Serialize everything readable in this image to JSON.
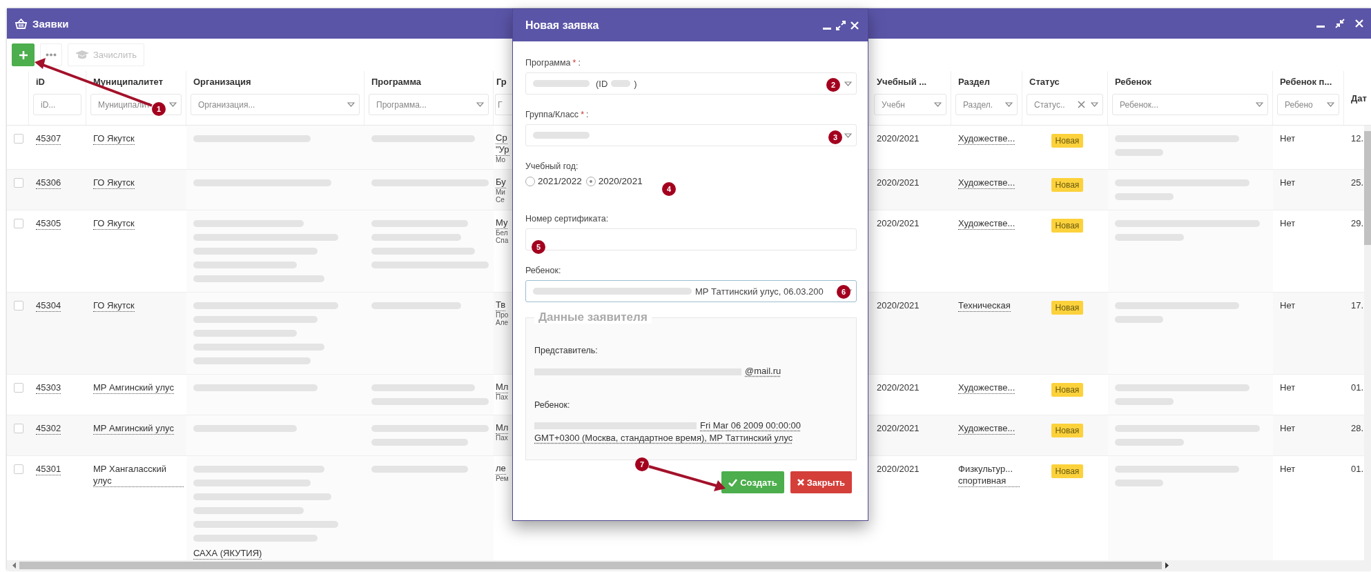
{
  "window": {
    "title": "Заявки"
  },
  "toolbar": {
    "enroll": {
      "label": "Зачислить",
      "disabled": true
    }
  },
  "table": {
    "columns": [
      {
        "title": "iD",
        "placeholder": "iD...",
        "dropdown": false
      },
      {
        "title": "Муниципалитет",
        "placeholder": "Муниципалит",
        "dropdown": true
      },
      {
        "title": "Организация",
        "placeholder": "Организация...",
        "dropdown": true
      },
      {
        "title": "Программа",
        "placeholder": "Программа...",
        "dropdown": true
      },
      {
        "title": "Гр",
        "placeholder": "Г",
        "dropdown": false
      },
      {
        "title": "Учебный ...",
        "placeholder": "Учебн",
        "dropdown": true
      },
      {
        "title": "Раздел",
        "placeholder": "Раздел.",
        "dropdown": true
      },
      {
        "title": "Статус",
        "placeholder": "Статус..",
        "dropdown": true,
        "clearable": true
      },
      {
        "title": "Ребенок",
        "placeholder": "Ребенок...",
        "dropdown": true
      },
      {
        "title": "Ребенок п...",
        "placeholder": "Ребено",
        "dropdown": true
      },
      {
        "title": "Дат"
      }
    ],
    "rows": [
      {
        "checked": false,
        "id": "45307",
        "municipality": "ГО Якутск",
        "group": [
          {
            "text": "Ср",
            "kind": "link"
          },
          {
            "text": "\"Ур",
            "kind": "link"
          },
          {
            "text": "Мо",
            "kind": "note"
          }
        ],
        "year": "2020/2021",
        "section": "Художестве...",
        "status": "Новая",
        "child_flag": "Нет",
        "date": "12."
      },
      {
        "checked": false,
        "id": "45306",
        "municipality": "ГО Якутск",
        "group": [
          {
            "text": "Бу",
            "kind": "link"
          },
          {
            "text": "Ми",
            "kind": "note"
          },
          {
            "text": "Се",
            "kind": "note"
          }
        ],
        "year": "2020/2021",
        "section": "Художестве...",
        "status": "Новая",
        "child_flag": "Нет",
        "date": "25."
      },
      {
        "checked": false,
        "id": "45305",
        "municipality": "ГО Якутск",
        "group": [
          {
            "text": "Му",
            "kind": "link"
          },
          {
            "text": "Бел",
            "kind": "note"
          },
          {
            "text": "Спа",
            "kind": "note"
          }
        ],
        "year": "2020/2021",
        "section": "Художестве...",
        "status": "Новая",
        "child_flag": "Нет",
        "date": "29."
      },
      {
        "checked": false,
        "id": "45304",
        "municipality": "ГО Якутск",
        "group": [
          {
            "text": "Тв",
            "kind": "link"
          },
          {
            "text": "Про",
            "kind": "note"
          },
          {
            "text": "Але",
            "kind": "note"
          }
        ],
        "year": "2020/2021",
        "section": "Техническая",
        "status": "Новая",
        "child_flag": "Нет",
        "date": "17."
      },
      {
        "checked": false,
        "id": "45303",
        "municipality": "МР Амгинский улус",
        "group": [
          {
            "text": "Мл",
            "kind": "link"
          },
          {
            "text": "Пах",
            "kind": "note"
          }
        ],
        "year": "2020/2021",
        "section": "Художестве...",
        "status": "Новая",
        "child_flag": "Нет",
        "date": "01."
      },
      {
        "checked": false,
        "id": "45302",
        "municipality": "МР Амгинский улус",
        "group": [
          {
            "text": "Мл",
            "kind": "link"
          },
          {
            "text": "Пах",
            "kind": "note"
          }
        ],
        "year": "2020/2021",
        "section": "Художестве...",
        "status": "Новая",
        "child_flag": "Нет",
        "date": "28."
      },
      {
        "checked": false,
        "id": "45301",
        "municipality": "МР Хангаласский улус",
        "organization_tail": "САХА (ЯКУТИЯ)",
        "group": [
          {
            "text": "ле",
            "kind": "link"
          },
          {
            "text": "Рем",
            "kind": "note"
          }
        ],
        "year": "2020/2021",
        "section": "Физкультур... спортивная",
        "status": "Новая",
        "child_flag": "Нет",
        "date": "01."
      }
    ]
  },
  "dialog": {
    "title": "Новая заявка",
    "fields": [
      {
        "kind": "select",
        "label": "Программа",
        "required_mark": "*",
        "suffix": ":",
        "value_before": "(ID",
        "value_after": ")"
      },
      {
        "kind": "select",
        "label": "Группа/Класс",
        "required_mark": "*",
        "suffix": ":"
      },
      {
        "kind": "radio",
        "label": "Учебный год:",
        "options": [
          {
            "label": "2021/2022",
            "selected": false
          },
          {
            "label": "2020/2021",
            "selected": true
          }
        ]
      },
      {
        "kind": "input",
        "label": "Номер сертификата:"
      },
      {
        "kind": "combo",
        "label": "Ребенок:",
        "value": "МР Таттинский улус, 06.03.200",
        "focused": true
      }
    ],
    "applicant": {
      "legend": "Данные заявителя",
      "items": [
        {
          "label": "Представитель:",
          "value": "@mail.ru"
        },
        {
          "label": "Ребенок:",
          "value": "Fri Mar 06 2009 00:00:00 GMT+0300 (Москва, стандартное время), МР Таттинский улус"
        }
      ]
    },
    "buttons": [
      {
        "label": "Создать",
        "kind": "primary"
      },
      {
        "label": "Закрыть",
        "kind": "danger"
      }
    ]
  },
  "annotations": [
    {
      "number": "1"
    },
    {
      "number": "2"
    },
    {
      "number": "3"
    },
    {
      "number": "4"
    },
    {
      "number": "5"
    },
    {
      "number": "6"
    },
    {
      "number": "7"
    }
  ]
}
